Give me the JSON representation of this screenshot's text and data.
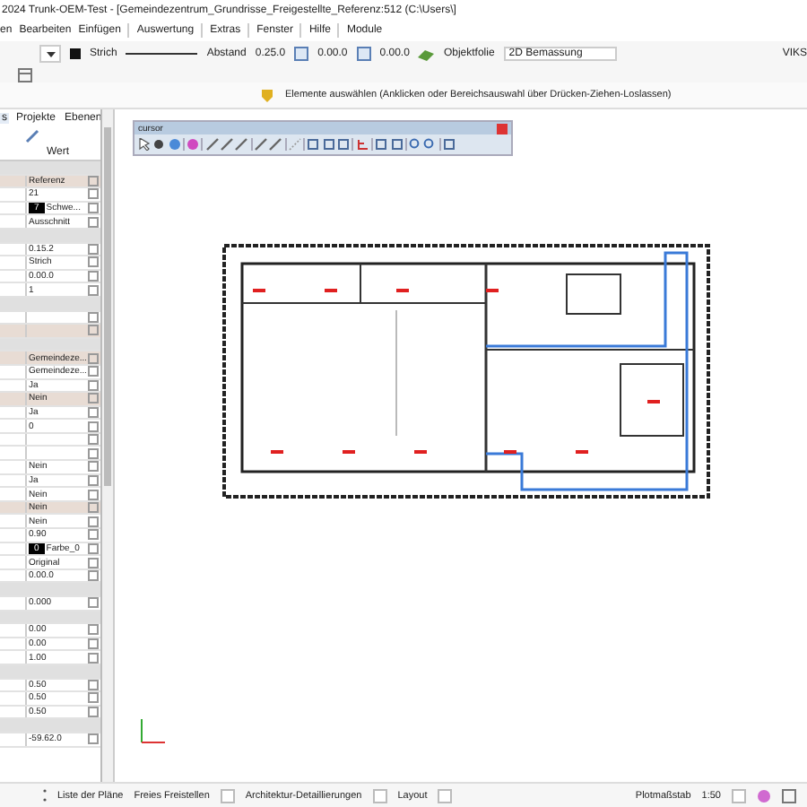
{
  "window": {
    "title": "2024 Trunk-OEM-Test - [Gemeindezentrum_Grundrisse_Freigestellte_Referenz:512 (C:\\Users\\]"
  },
  "menu": [
    "en",
    "Bearbeiten",
    "Einfügen",
    "Auswertung",
    "Extras",
    "Fenster",
    "Hilfe",
    "Module"
  ],
  "toolbar": {
    "line_type": "Strich",
    "distance_label": "Abstand",
    "distance": "0.25.0",
    "offset_1": "0.00.0",
    "offset_2": "0.00.0",
    "object_film": "Objektfolie",
    "dimension": "2D Bemassung",
    "cut_label": "VIKS"
  },
  "prompt": "Elemente auswählen (Anklicken oder Bereichsauswahl über Drücken-Ziehen-Loslassen)",
  "panel": {
    "tabs": [
      {
        "label": "s",
        "selected": true
      },
      {
        "label": "Projekte",
        "selected": false
      },
      {
        "label": "Ebenen",
        "selected": false
      }
    ],
    "column": "Wert",
    "rows": [
      {
        "kind": "section"
      },
      {
        "kind": "value",
        "value": "Referenz",
        "highlighted": true
      },
      {
        "kind": "value",
        "value": "21",
        "highlighted": false
      },
      {
        "kind": "color",
        "swatch": "7",
        "value": "Schwe...",
        "highlighted": false
      },
      {
        "kind": "value",
        "value": "Ausschnitt",
        "highlighted": false
      },
      {
        "kind": "section"
      },
      {
        "kind": "value",
        "value": "0.15.2",
        "highlighted": false
      },
      {
        "kind": "value",
        "value": "Strich",
        "highlighted": false
      },
      {
        "kind": "value",
        "value": "0.00.0",
        "highlighted": false
      },
      {
        "kind": "value",
        "value": "1",
        "highlighted": false
      },
      {
        "kind": "section"
      },
      {
        "kind": "empty",
        "highlighted": false
      },
      {
        "kind": "empty",
        "highlighted": true
      },
      {
        "kind": "section"
      },
      {
        "kind": "value",
        "value": "Gemeindeze...",
        "highlighted": true
      },
      {
        "kind": "value",
        "value": "Gemeindeze...",
        "highlighted": false
      },
      {
        "kind": "value",
        "value": "Ja",
        "highlighted": false
      },
      {
        "kind": "value",
        "value": "Nein",
        "highlighted": true
      },
      {
        "kind": "value",
        "value": "Ja",
        "highlighted": false
      },
      {
        "kind": "value",
        "value": "0",
        "highlighted": false
      },
      {
        "kind": "empty",
        "highlighted": false
      },
      {
        "kind": "empty",
        "highlighted": false
      },
      {
        "kind": "value",
        "value": "Nein",
        "highlighted": false
      },
      {
        "kind": "value",
        "value": "Ja",
        "highlighted": false
      },
      {
        "kind": "value",
        "value": "Nein",
        "highlighted": false
      },
      {
        "kind": "value",
        "value": "Nein",
        "highlighted": true
      },
      {
        "kind": "value",
        "value": "Nein",
        "highlighted": false
      },
      {
        "kind": "value",
        "value": "0.90",
        "highlighted": false
      },
      {
        "kind": "color",
        "swatch": "0",
        "value": "Farbe_0",
        "highlighted": false
      },
      {
        "kind": "value",
        "value": "Original",
        "highlighted": false
      },
      {
        "kind": "value",
        "value": "0.00.0",
        "highlighted": false
      },
      {
        "kind": "section"
      },
      {
        "kind": "value",
        "value": "0.000",
        "highlighted": false
      },
      {
        "kind": "section"
      },
      {
        "kind": "value",
        "value": "0.00",
        "highlighted": false
      },
      {
        "kind": "value",
        "value": "0.00",
        "highlighted": false
      },
      {
        "kind": "value",
        "value": "1.00",
        "highlighted": false
      },
      {
        "kind": "section"
      },
      {
        "kind": "value",
        "value": "0.50",
        "highlighted": false
      },
      {
        "kind": "value",
        "value": "0.50",
        "highlighted": false
      },
      {
        "kind": "value",
        "value": "0.50",
        "highlighted": false
      },
      {
        "kind": "section"
      },
      {
        "kind": "value",
        "value": "-59.62.0",
        "highlighted": false
      }
    ]
  },
  "cursor_toolbar": {
    "title": "cursor"
  },
  "status_bar": {
    "plans": "Liste der Pläne",
    "mode": "Freies Freistellen",
    "detail": "Architektur-Detaillierungen",
    "layout": "Layout",
    "scale_label": "Plotmaßstab",
    "scale": "1:50"
  }
}
